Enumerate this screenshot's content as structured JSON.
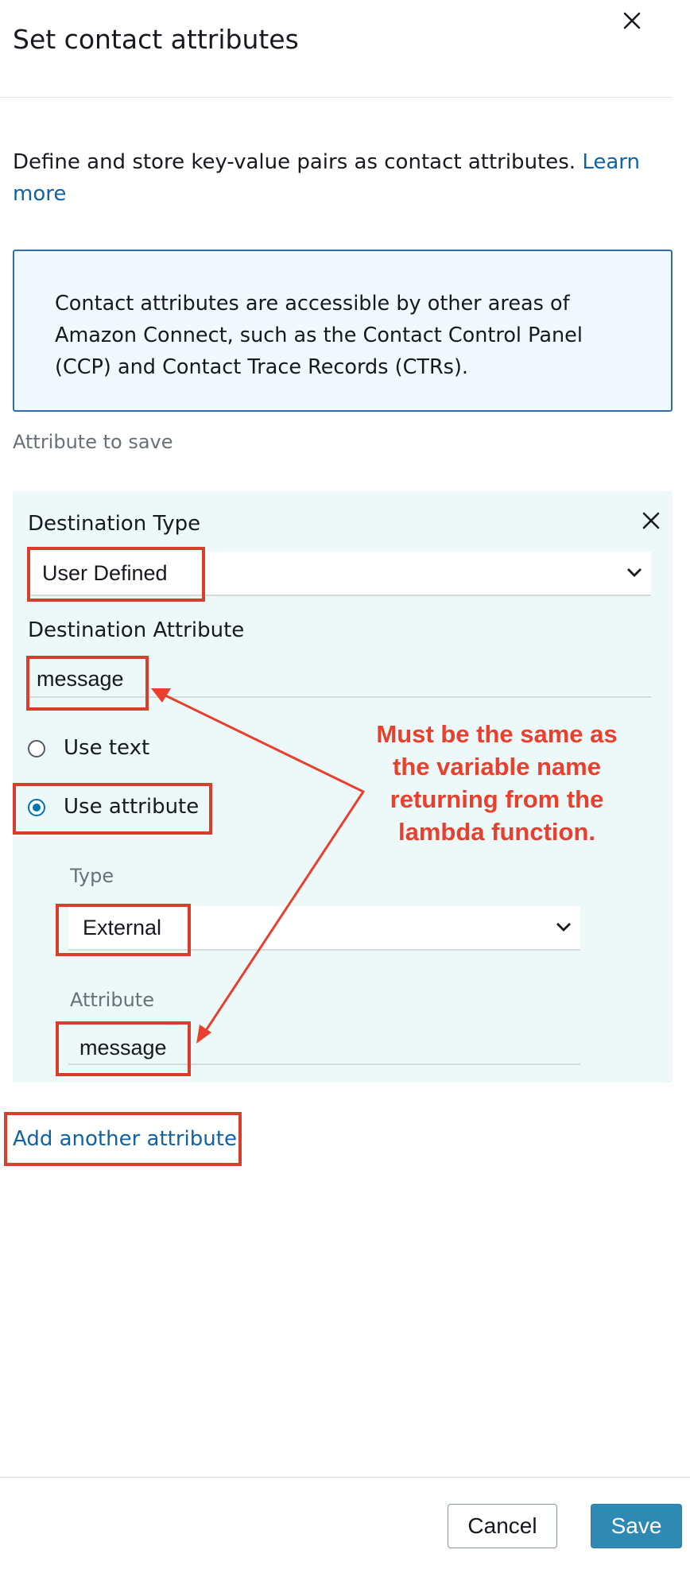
{
  "panel": {
    "title": "Set contact attributes",
    "intro_text": "Define and store key-value pairs as contact attributes.",
    "learn_more_link": "Learn more",
    "info_text": "Contact attributes are accessible by other areas of Amazon Connect, such as the Contact Control Panel (CCP) and Contact Trace Records (CTRs).",
    "section_label": "Attribute to save"
  },
  "attribute": {
    "destination_type_label": "Destination Type",
    "destination_type_value": "User Defined",
    "destination_attribute_label": "Destination Attribute",
    "destination_attribute_value": "message",
    "option_use_text": "Use text",
    "option_use_attribute": "Use attribute",
    "selected_option": "Use attribute",
    "type_label": "Type",
    "type_value": "External",
    "attribute_label": "Attribute",
    "attribute_value": "message"
  },
  "annotation": {
    "note": "Must be the same as the variable name returning from the lambda function.",
    "color": "#e8402c"
  },
  "add_link": "Add another attribute",
  "footer": {
    "cancel_label": "Cancel",
    "save_label": "Save"
  },
  "colors": {
    "link": "#0f63a5",
    "save_button": "#2f8ab3",
    "card_background": "#edf8f9",
    "info_background": "#f1f8ff",
    "highlight_border": "#d93d2b"
  }
}
